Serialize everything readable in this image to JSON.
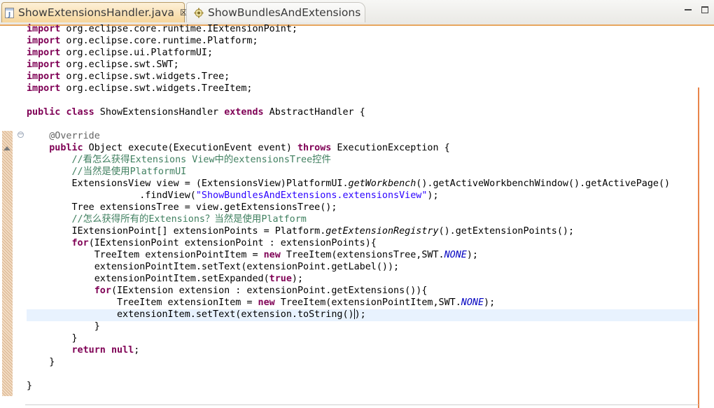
{
  "tabs": [
    {
      "label": "ShowExtensionsHandler.java",
      "active": true,
      "icon": "java-file-icon",
      "close": "☒"
    },
    {
      "label": "ShowBundlesAndExtensions",
      "active": false,
      "icon": "plugin-manifest-icon"
    }
  ],
  "window_controls": {
    "minimize": "minimize-icon",
    "maximize": "maximize-icon"
  },
  "colors": {
    "keyword": "#7f0055",
    "comment": "#3f7f5f",
    "string": "#2a00ff",
    "annotation": "#646464",
    "static_field": "#0000c0",
    "current_line": "#e8f2fe",
    "active_tab": "#f6d69c",
    "edge_marker": "#e8844a"
  },
  "code": {
    "l1": [
      "import",
      " org.eclipse.core.runtime.IExtensionPoint;"
    ],
    "l2": [
      "import",
      " org.eclipse.core.runtime.Platform;"
    ],
    "l3": [
      "import",
      " org.eclipse.ui.PlatformUI;"
    ],
    "l4": [
      "import",
      " org.eclipse.swt.SWT;"
    ],
    "l5": [
      "import",
      " org.eclipse.swt.widgets.Tree;"
    ],
    "l6": [
      "import",
      " org.eclipse.swt.widgets.TreeItem;"
    ],
    "l8": [
      "public",
      " ",
      "class",
      " ShowExtensionsHandler ",
      "extends",
      " AbstractHandler {"
    ],
    "l10": [
      "    ",
      "@Override"
    ],
    "l11": [
      "    ",
      "public",
      " Object execute(ExecutionEvent event) ",
      "throws",
      " ExecutionException {"
    ],
    "l12": [
      "        ",
      "//看怎么获得Extensions View中的extensionsTree控件"
    ],
    "l13": [
      "        ",
      "//当然是使用PlatformUI"
    ],
    "l14": [
      "        ExtensionsView view = (ExtensionsView)PlatformUI.",
      "getWorkbench",
      "().getActiveWorkbenchWindow().getActivePage()"
    ],
    "l15": [
      "                    .findView(",
      "\"ShowBundlesAndExtensions.extensionsView\"",
      ");"
    ],
    "l16": [
      "        Tree extensionsTree = view.getExtensionsTree();"
    ],
    "l17": [
      "        ",
      "//怎么获得所有的Extensions？当然是使用Platform"
    ],
    "l18": [
      "        IExtensionPoint[] extensionPoints = Platform.",
      "getExtensionRegistry",
      "().getExtensionPoints();"
    ],
    "l19": [
      "        ",
      "for",
      "(IExtensionPoint extensionPoint : extensionPoints){"
    ],
    "l20": [
      "            TreeItem extensionPointItem = ",
      "new",
      " TreeItem(extensionsTree,SWT.",
      "NONE",
      ");"
    ],
    "l21": [
      "            extensionPointItem.setText(extensionPoint.getLabel());"
    ],
    "l22": [
      "            extensionPointItem.setExpanded(",
      "true",
      ");"
    ],
    "l23": [
      "            ",
      "for",
      "(IExtension extension : extensionPoint.getExtensions()){"
    ],
    "l24": [
      "                TreeItem extensionItem = ",
      "new",
      " TreeItem(extensionPointItem,SWT.",
      "NONE",
      ");"
    ],
    "l25": [
      "                extensionItem.setText(extension.toString()",
      ");"
    ],
    "l26": [
      "            }"
    ],
    "l27": [
      "        }"
    ],
    "l28": [
      "        ",
      "return",
      " ",
      "null",
      ";"
    ],
    "l29": [
      "    }"
    ],
    "l31": [
      "}"
    ]
  }
}
